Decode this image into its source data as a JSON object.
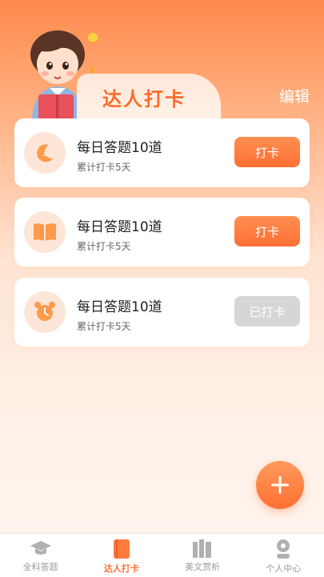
{
  "header": {
    "title": "达人打卡",
    "edit_label": "编辑"
  },
  "cards": [
    {
      "title": "每日答题10道",
      "subtitle": "累计打卡5天",
      "button": "打卡",
      "done": false,
      "icon": "moon-icon"
    },
    {
      "title": "每日答题10道",
      "subtitle": "累计打卡5天",
      "button": "打卡",
      "done": false,
      "icon": "book-icon"
    },
    {
      "title": "每日答题10道",
      "subtitle": "累计打卡5天",
      "button": "已打卡",
      "done": true,
      "icon": "alarm-clock-icon"
    }
  ],
  "fab": {
    "icon": "plus-icon"
  },
  "nav": {
    "items": [
      {
        "label": "全科答题",
        "icon": "graduation-cap-icon",
        "active": false
      },
      {
        "label": "达人打卡",
        "icon": "book-icon",
        "active": true
      },
      {
        "label": "美文赏析",
        "icon": "books-icon",
        "active": false
      },
      {
        "label": "个人中心",
        "icon": "user-icon",
        "active": false
      }
    ]
  },
  "colors": {
    "accent": "#ff6f33",
    "inactive": "#9a9a9a",
    "done_button": "#d6d6d6"
  }
}
